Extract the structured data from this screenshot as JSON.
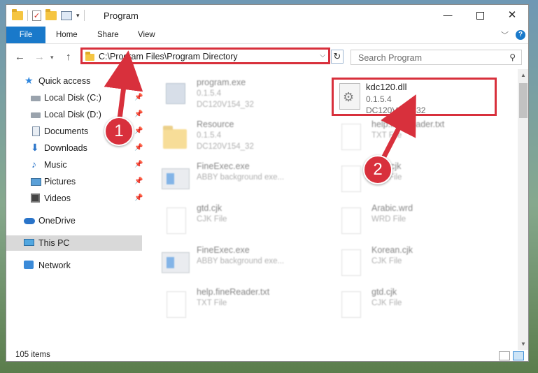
{
  "window": {
    "title": "Program",
    "controls": {
      "minimize": "—",
      "maximize": "",
      "close": "✕"
    }
  },
  "ribbon": {
    "tabs": [
      "File",
      "Home",
      "Share",
      "View"
    ],
    "help": "?"
  },
  "address_bar": {
    "path": "C:\\Program Files\\Program Directory",
    "refresh": "↻"
  },
  "search": {
    "placeholder": "Search Program"
  },
  "sidebar": {
    "items": [
      {
        "label": "Quick access",
        "icon": "star-icon"
      },
      {
        "label": "Local Disk (C:)",
        "icon": "drive-icon",
        "pinned": true
      },
      {
        "label": "Local Disk (D:)",
        "icon": "drive-icon",
        "pinned": true
      },
      {
        "label": "Documents",
        "icon": "documents-icon",
        "pinned": true
      },
      {
        "label": "Downloads",
        "icon": "download-icon",
        "pinned": true
      },
      {
        "label": "Music",
        "icon": "music-icon",
        "pinned": true
      },
      {
        "label": "Pictures",
        "icon": "pictures-icon",
        "pinned": true
      },
      {
        "label": "Videos",
        "icon": "videos-icon",
        "pinned": true
      },
      {
        "label": "OneDrive",
        "icon": "cloud-icon"
      },
      {
        "label": "This PC",
        "icon": "pc-icon",
        "selected": true
      },
      {
        "label": "Network",
        "icon": "network-icon"
      }
    ]
  },
  "files": [
    {
      "name": "program.exe",
      "line1": "0.1.5.4",
      "line2": "DC120V154_32",
      "kind": "exe"
    },
    {
      "name": "Resource",
      "line1": "0.1.5.4",
      "line2": "DC120V154_32",
      "kind": "folder"
    },
    {
      "name": "FineExec.exe",
      "line1": "ABBY background exe...",
      "line2": "",
      "kind": "app"
    },
    {
      "name": "gtd.cjk",
      "line1": "CJK File",
      "line2": "",
      "kind": "doc"
    },
    {
      "name": "FineExec.exe",
      "line1": "ABBY background exe...",
      "line2": "",
      "kind": "app"
    },
    {
      "name": "help.fineReader.txt",
      "line1": "TXT File",
      "line2": "",
      "kind": "doc"
    },
    {
      "name": "help.fineReader.txt",
      "line1": "TXT File",
      "line2": "",
      "kind": "doc"
    },
    {
      "name": "html.cjk",
      "line1": "CJK File",
      "line2": "",
      "kind": "doc"
    },
    {
      "name": "Arabic.wrd",
      "line1": "WRD File",
      "line2": "",
      "kind": "doc"
    },
    {
      "name": "Korean.cjk",
      "line1": "CJK File",
      "line2": "",
      "kind": "doc"
    },
    {
      "name": "gtd.cjk",
      "line1": "CJK File",
      "line2": "",
      "kind": "doc"
    }
  ],
  "highlighted_file": {
    "name": "kdc120.dll",
    "line1": "0.1.5.4",
    "line2": "DC120V154_32",
    "icon": "gear-dll-icon"
  },
  "status": {
    "item_count": "105 items"
  },
  "annotations": {
    "step1": "1",
    "step2": "2",
    "color": "#d8303c"
  },
  "colors": {
    "accent": "#1979ca",
    "highlight": "#d8303c",
    "selected_bg": "#d9d9d9"
  }
}
